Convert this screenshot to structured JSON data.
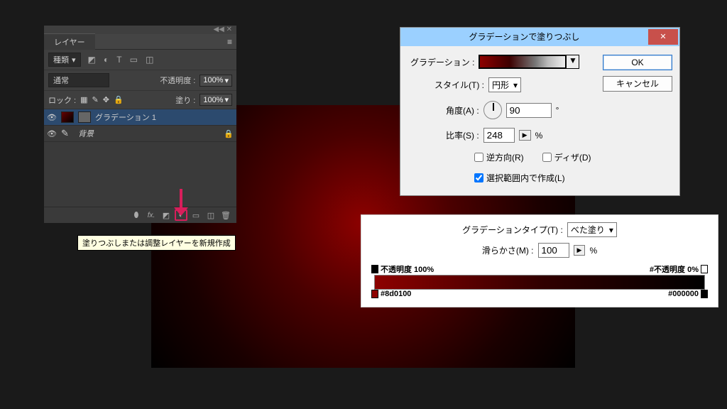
{
  "layers_panel": {
    "title": "レイヤー",
    "kind_label": "種類",
    "icons": [
      "◩",
      "◐",
      "T",
      "▭",
      "◫"
    ],
    "blend_label": "通常",
    "opacity_label": "不透明度 :",
    "opacity_value": "100%",
    "lock_label": "ロック :",
    "fill_label": "塗り :",
    "fill_value": "100%",
    "lock_icons": [
      "▦",
      "✎",
      "✥",
      "🔒"
    ],
    "layers": [
      {
        "name": "グラデーション 1",
        "locked": false,
        "selected": true
      },
      {
        "name": "背景",
        "locked": true,
        "selected": false
      }
    ],
    "footer_icons": [
      "⬮",
      "fx.",
      "◩",
      "◐",
      "▭",
      "🗑"
    ],
    "tooltip": "塗りつぶしまたは調整レイヤーを新規作成"
  },
  "gradient_dialog": {
    "title": "グラデーションで塗りつぶし",
    "gradient_label": "グラデーション :",
    "style_label": "スタイル(T) :",
    "style_value": "円形",
    "angle_label": "角度(A) :",
    "angle_value": "90",
    "angle_unit": "°",
    "scale_label": "比率(S) :",
    "scale_value": "248",
    "scale_unit": "%",
    "reverse_label": "逆方向(R)",
    "dither_label": "ディザ(D)",
    "align_label": "選択範囲内で作成(L)",
    "ok": "OK",
    "cancel": "キャンセル"
  },
  "gradient_editor": {
    "type_label": "グラデーションタイプ(T) :",
    "type_value": "べた塗り",
    "smooth_label": "滑らかさ(M) :",
    "smooth_value": "100",
    "smooth_unit": "%",
    "opacity_left": "不透明度  100%",
    "opacity_right": "#不透明度  0%",
    "color_left": "#8d0100",
    "color_right": "#000000"
  }
}
